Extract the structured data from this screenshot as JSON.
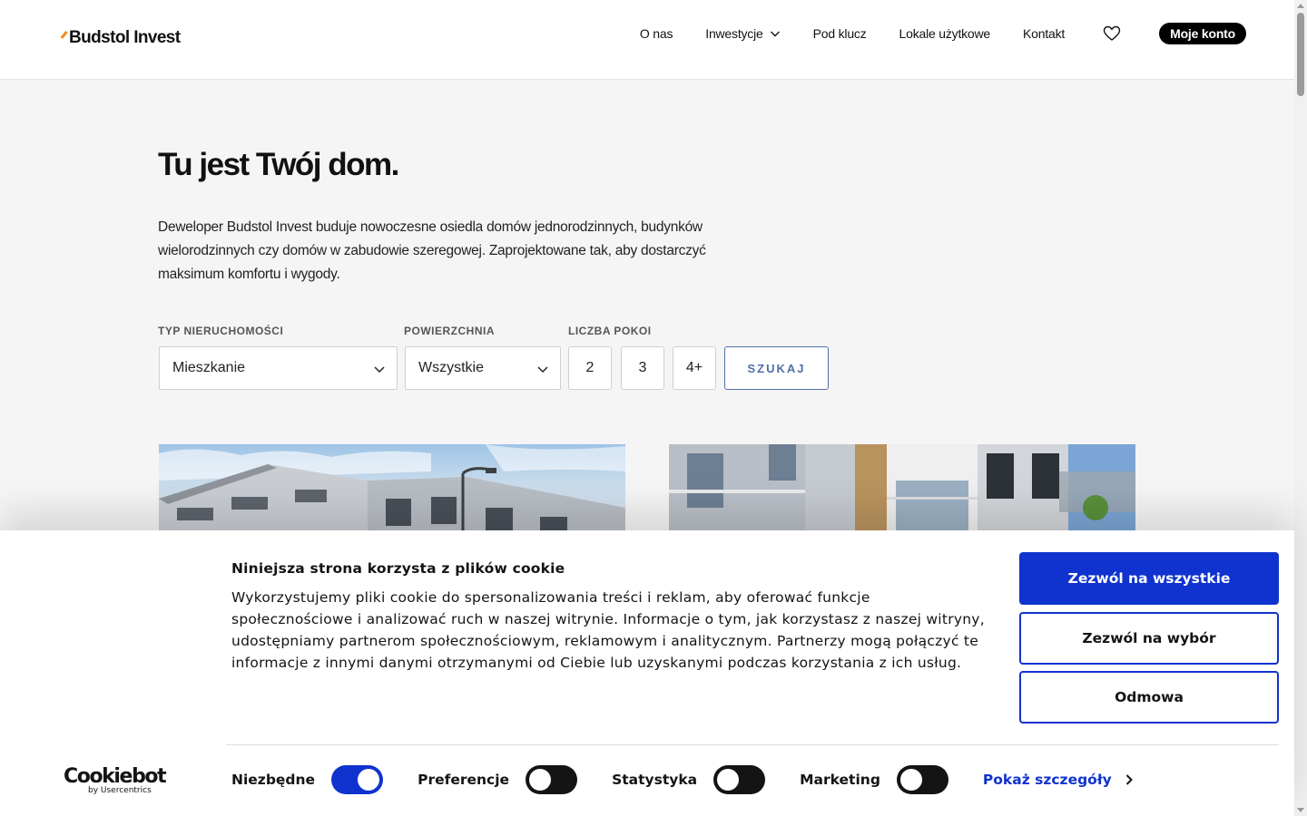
{
  "header": {
    "logo_text": "Budstol Invest",
    "nav": [
      "O nas",
      "Inwestycje",
      "Pod klucz",
      "Lokale użytkowe",
      "Kontakt"
    ],
    "account_label": "Moje konto"
  },
  "hero": {
    "title": "Tu jest Twój dom.",
    "description": "Deweloper Budstol Invest buduje nowoczesne osiedla domów jednorodzinnych, budynków wielorodzinnych czy domów w zabudowie szeregowej. Zaprojektowane tak, aby dostarczyć maksimum komfortu i wygody."
  },
  "filters": {
    "type_label": "TYP NIERUCHOMOŚCI",
    "type_value": "Mieszkanie",
    "area_label": "POWIERZCHNIA",
    "area_value": "Wszystkie",
    "rooms_label": "LICZBA POKOI",
    "rooms": [
      "2",
      "3",
      "4+"
    ],
    "search_label": "SZUKAJ"
  },
  "cookie": {
    "title": "Niniejsza strona korzysta z plików cookie",
    "text": "Wykorzystujemy pliki cookie do spersonalizowania treści i reklam, aby oferować funkcje społecznościowe i analizować ruch w naszej witrynie. Informacje o tym, jak korzystasz z naszej witryny, udostępniamy partnerom społecznościowym, reklamowym i analitycznym. Partnerzy mogą połączyć te informacje z innymi danymi otrzymanymi od Ciebie lub uzyskanymi podczas korzystania z ich usług.",
    "allow_all": "Zezwól na wszystkie",
    "allow_selection": "Zezwól na wybór",
    "deny": "Odmowa",
    "brand": "Cookiebot",
    "brand_sub": "by Usercentrics",
    "toggles": [
      {
        "label": "Niezbędne",
        "on": true
      },
      {
        "label": "Preferencje",
        "on": false
      },
      {
        "label": "Statystyka",
        "on": false
      },
      {
        "label": "Marketing",
        "on": false
      }
    ],
    "details_label": "Pokaż szczegóły"
  },
  "colors": {
    "accent_blue": "#1032cf",
    "logo_orange": "#f08c1c",
    "search_blue": "#4f6fa8"
  }
}
